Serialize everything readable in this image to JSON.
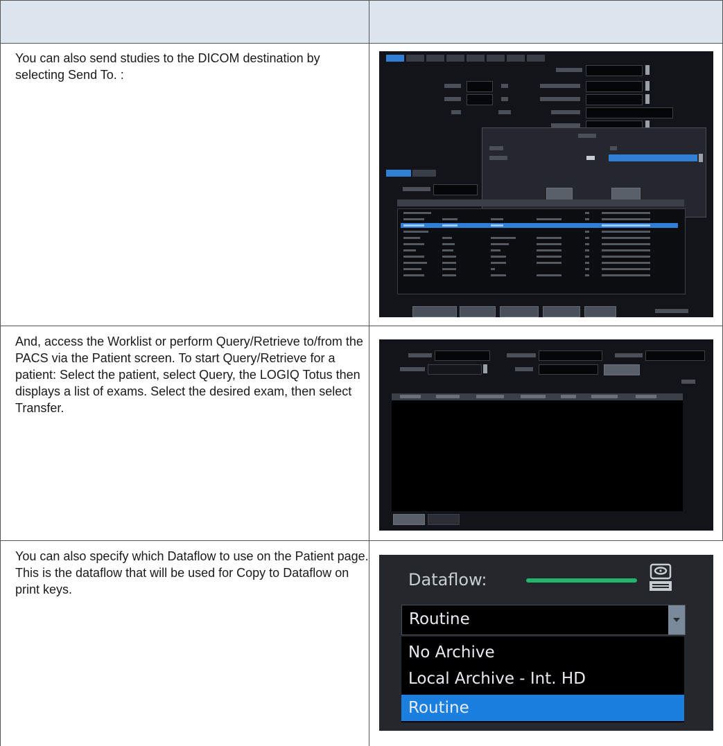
{
  "rows": [
    {
      "text": "You can also send studies to the DICOM destination by selecting Send To. :"
    },
    {
      "text": "And, access the Worklist or perform Query/Retrieve to/from the PACS via the Patient screen. To start Query/Retrieve  for a patient: Select the patient, select Query, the LOGIQ Totus then displays a list of exams. Select the desired exam, then select Transfer."
    },
    {
      "text": "You can also specify which Dataflow to use on the Patient page. This is the dataflow that will be used for Copy to Dataflow on print keys."
    }
  ],
  "dataflow_panel": {
    "label": "Dataflow:",
    "selected_value": "Routine",
    "options": [
      "No Archive",
      "Local Archive - Int. HD",
      "Routine"
    ],
    "selected_option_index": 2,
    "status_bar_color": "#23b56e",
    "selection_color": "#1b7fe0",
    "icon": "archive-drive-icon"
  },
  "colors": {
    "header_background": "#dce4ee",
    "screen_background": "#121419",
    "highlight_blue": "#2f7fd6"
  }
}
